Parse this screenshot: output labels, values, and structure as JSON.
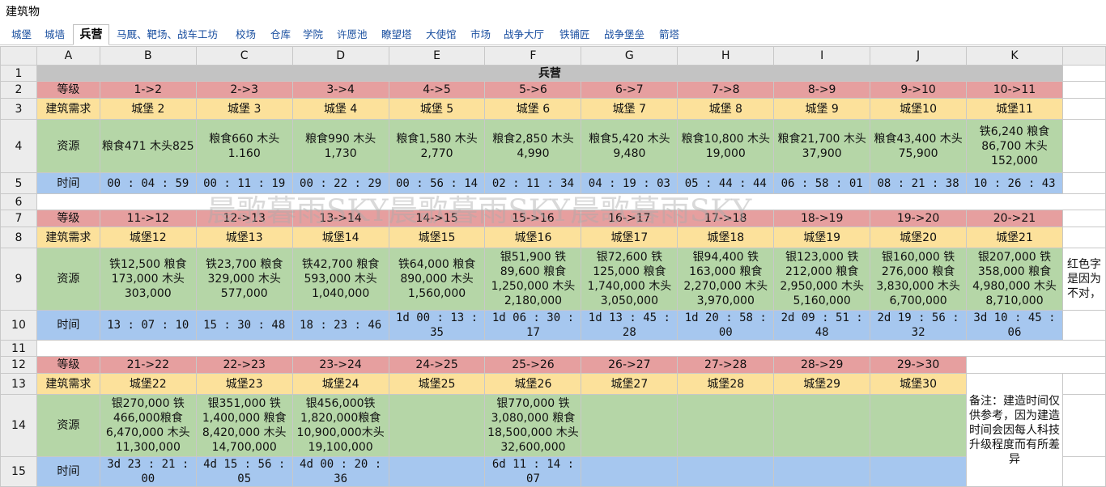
{
  "window_title": "建筑物",
  "tabs": [
    "城堡",
    "城墙",
    "兵营",
    "马厩、靶场、战车工坊",
    "校场",
    "仓库",
    "学院",
    "许愿池",
    "瞭望塔",
    "大使馆",
    "市场",
    "战争大厅",
    "铁铺匠",
    "战争堡垒",
    "箭塔"
  ],
  "active_tab": "兵营",
  "columns": [
    "A",
    "B",
    "C",
    "D",
    "E",
    "F",
    "G",
    "H",
    "I",
    "J",
    "K"
  ],
  "rows": [
    "1",
    "2",
    "3",
    "4",
    "5",
    "6",
    "7",
    "8",
    "9",
    "10",
    "11",
    "12",
    "13",
    "14",
    "15"
  ],
  "sheet_title": "兵营",
  "labels": {
    "level": "等级",
    "requirement": "建筑需求",
    "resources": "资源",
    "time": "时间"
  },
  "blocks": [
    {
      "levels": [
        "1->2",
        "2->3",
        "3->4",
        "4->5",
        "5->6",
        "6->7",
        "7->8",
        "8->9",
        "9->10",
        "10->11"
      ],
      "requirements": [
        "城堡 2",
        "城堡 3",
        "城堡 4",
        "城堡 5",
        "城堡 6",
        "城堡 7",
        "城堡 8",
        "城堡 9",
        "城堡10",
        "城堡11"
      ],
      "resources": [
        "粮食471 木头825",
        "粮食660 木头1.160",
        "粮食990 木头1,730",
        "粮食1,580 木头2,770",
        "粮食2,850 木头4,990",
        "粮食5,420 木头9,480",
        "粮食10,800 木头19,000",
        "粮食21,700 木头37,900",
        "粮食43,400 木头75,900",
        "铁6,240 粮食86,700 木头152,000"
      ],
      "times": [
        "00 : 04 : 59",
        "00 : 11 : 19",
        "00 : 22 : 29",
        "00 : 56 : 14",
        "02 : 11 : 34",
        "04 : 19 : 03",
        "05 : 44 : 44",
        "06 : 58 : 01",
        "08 : 21 : 38",
        "10 : 26 : 43"
      ]
    },
    {
      "levels": [
        "11->12",
        "12->13",
        "13->14",
        "14->15",
        "15->16",
        "16->17",
        "17->18",
        "18->19",
        "19->20",
        "20->21"
      ],
      "requirements": [
        "城堡12",
        "城堡13",
        "城堡14",
        "城堡15",
        "城堡16",
        "城堡17",
        "城堡18",
        "城堡19",
        "城堡20",
        "城堡21"
      ],
      "resources": [
        "铁12,500 粮食173,000 木头303,000",
        "铁23,700 粮食329,000 木头577,000",
        "铁42,700 粮食593,000 木头1,040,000",
        "铁64,000 粮食890,000 木头1,560,000",
        "银51,900 铁89,600 粮食1,250,000 木头2,180,000",
        "银72,600 铁125,000 粮食1,740,000 木头3,050,000",
        "银94,400 铁163,000 粮食2,270,000 木头3,970,000",
        "银123,000 铁212,000 粮食2,950,000 木头5,160,000",
        "银160,000 铁276,000 粮食3,830,000 木头6,700,000",
        "银207,000 铁358,000 粮食4,980,000 木头8,710,000"
      ],
      "times": [
        "13 : 07 : 10",
        "15 : 30 : 48",
        "18 : 23 : 46",
        "1d 00 : 13 : 35",
        "1d 06 : 30 : 17",
        "1d 13 : 45 : 28",
        "1d 20 : 58 : 00",
        "2d 09 : 51 : 48",
        "2d 19 : 56 : 32",
        "3d 10 : 45 : 06"
      ]
    },
    {
      "levels": [
        "21->22",
        "22->23",
        "23->24",
        "24->25",
        "25->26",
        "26->27",
        "27->28",
        "28->29",
        "29->30"
      ],
      "requirements": [
        "城堡22",
        "城堡23",
        "城堡24",
        "城堡25",
        "城堡26",
        "城堡27",
        "城堡28",
        "城堡29",
        "城堡30"
      ],
      "resources": [
        "银270,000 铁466,000粮食6,470,000 木头11,300,000",
        "银351,000 铁1,400,000 粮食8,420,000 木头14,700,000",
        "银456,000铁1,820,000粮食10,900,000木头19,100,000",
        "",
        "银770,000 铁3,080,000 粮食18,500,000 木头32,600,000",
        "",
        "",
        "",
        ""
      ],
      "times": [
        "3d 23 : 21 : 00",
        "4d 15 : 56 : 05",
        "4d 00 : 20 : 36",
        "",
        "6d 11 : 14 : 07",
        "",
        "",
        "",
        ""
      ]
    }
  ],
  "side_note": "红色字是因为不对，",
  "remark": "备注：建造时间仅供参考，因为建造时间会因每人科技升级程度而有所差异",
  "watermark": "晨歌暮雨SKY晨歌暮雨SKY晨歌暮雨SKY",
  "colors": {
    "level": "#e69f9f",
    "requirement": "#fce19b",
    "resources": "#b5d6a7",
    "time": "#a6c7ef",
    "red_text": "#e21c1c"
  }
}
